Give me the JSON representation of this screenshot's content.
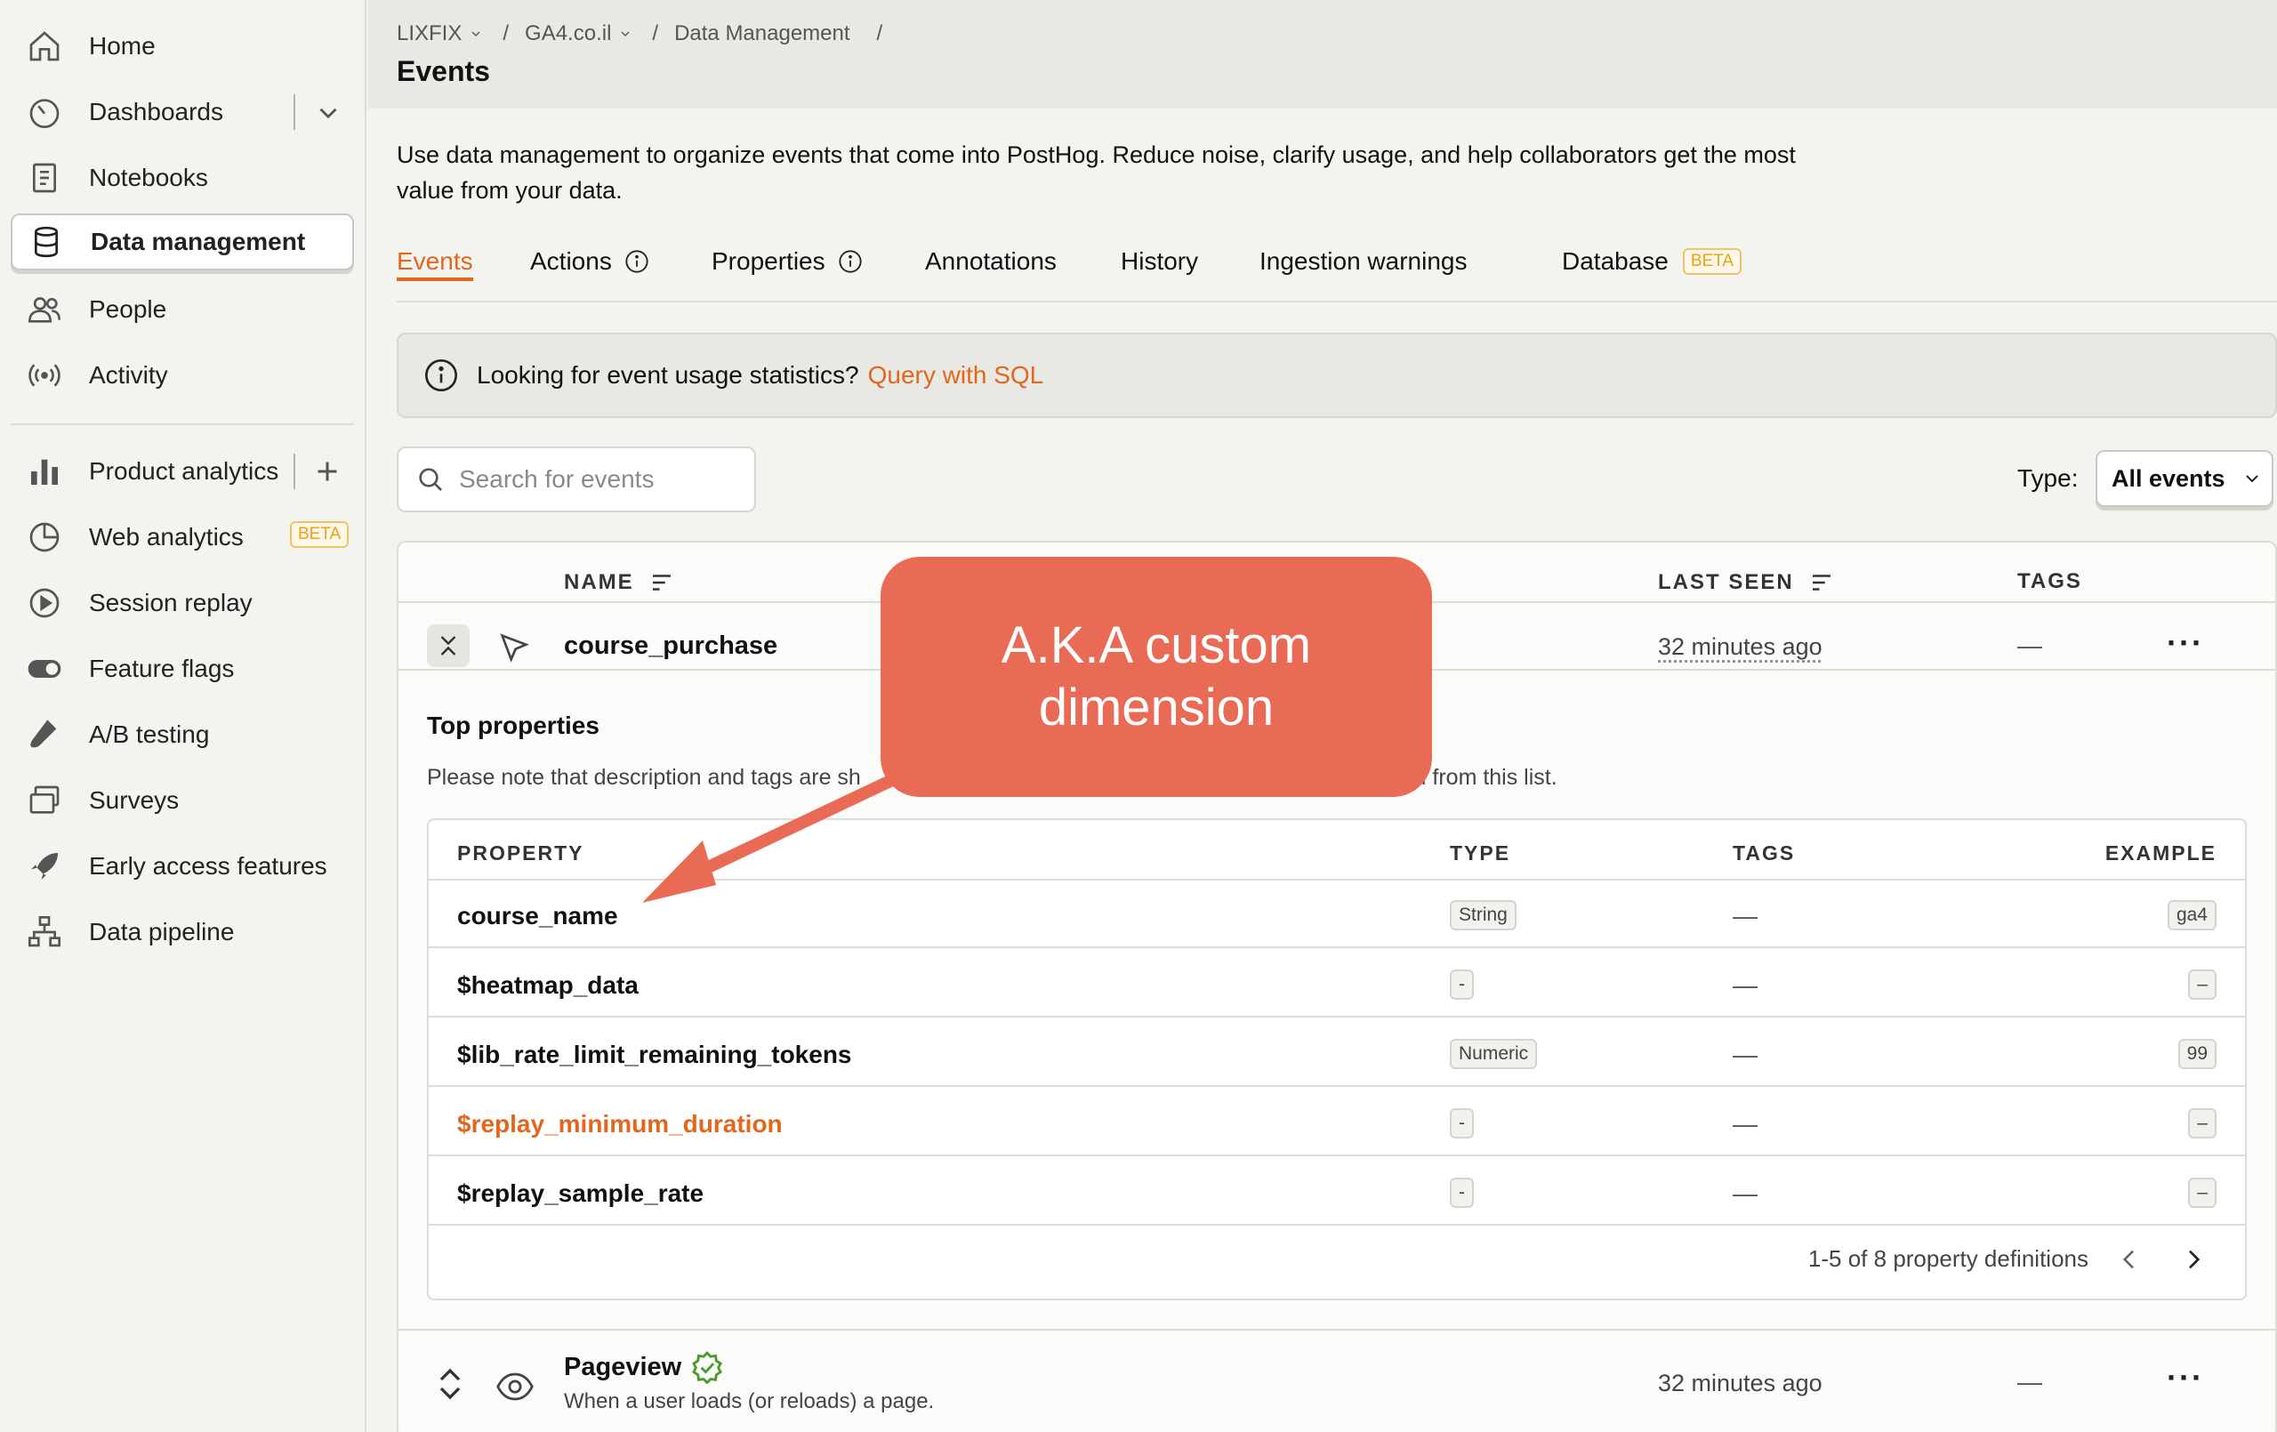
{
  "sidebar": {
    "items": [
      {
        "label": "Home",
        "icon": "home-icon"
      },
      {
        "label": "Dashboards",
        "icon": "dashboard-icon"
      },
      {
        "label": "Notebooks",
        "icon": "notebook-icon"
      },
      {
        "label": "Data management",
        "icon": "database-icon"
      },
      {
        "label": "People",
        "icon": "people-icon"
      },
      {
        "label": "Activity",
        "icon": "activity-icon"
      },
      {
        "label": "Product analytics",
        "icon": "bar-chart-icon"
      },
      {
        "label": "Web analytics",
        "icon": "pie-chart-icon",
        "badge": "BETA"
      },
      {
        "label": "Session replay",
        "icon": "replay-icon"
      },
      {
        "label": "Feature flags",
        "icon": "toggle-icon"
      },
      {
        "label": "A/B testing",
        "icon": "flask-icon"
      },
      {
        "label": "Surveys",
        "icon": "survey-icon"
      },
      {
        "label": "Early access features",
        "icon": "rocket-icon"
      },
      {
        "label": "Data pipeline",
        "icon": "pipeline-icon"
      }
    ]
  },
  "header": {
    "breadcrumbs": [
      "LIXFIX",
      "GA4.co.il",
      "Data Management"
    ],
    "title": "Events"
  },
  "main": {
    "description": "Use data management to organize events that come into PostHog. Reduce noise, clarify usage, and help collaborators get the most value from your data.",
    "tabs": [
      {
        "label": "Events"
      },
      {
        "label": "Actions"
      },
      {
        "label": "Properties"
      },
      {
        "label": "Annotations"
      },
      {
        "label": "History"
      },
      {
        "label": "Ingestion warnings"
      },
      {
        "label": "Database",
        "badge": "BETA"
      }
    ],
    "banner": {
      "text": "Looking for event usage statistics?",
      "link": "Query with SQL"
    },
    "search_placeholder": "Search for events",
    "type_label": "Type:",
    "type_value": "All events",
    "columns": {
      "name": "NAME",
      "last_seen": "LAST SEEN",
      "tags": "TAGS"
    },
    "events": [
      {
        "name": "course_purchase",
        "last_seen": "32 minutes ago",
        "tags": "—"
      },
      {
        "name": "Pageview",
        "description": "When a user loads (or reloads) a page.",
        "last_seen": "32 minutes ago",
        "tags": "—"
      }
    ],
    "top_properties": {
      "title": "Top properties",
      "note_start": "Please note that description and tags are sh",
      "note_end": "uded from this list.",
      "columns": {
        "property": "PROPERTY",
        "type": "TYPE",
        "tags": "TAGS",
        "example": "EXAMPLE"
      },
      "rows": [
        {
          "name": "course_name",
          "type": "String",
          "tags": "—",
          "example": "ga4"
        },
        {
          "name": "$heatmap_data",
          "type": "-",
          "tags": "—",
          "example": "–"
        },
        {
          "name": "$lib_rate_limit_remaining_tokens",
          "type": "Numeric",
          "tags": "—",
          "example": "99"
        },
        {
          "name": "$replay_minimum_duration",
          "type": "-",
          "tags": "—",
          "example": "–"
        },
        {
          "name": "$replay_sample_rate",
          "type": "-",
          "tags": "—",
          "example": "–"
        }
      ],
      "pagination": "1-5 of 8 property definitions"
    }
  },
  "annotation": {
    "text": "A.K.A custom dimension",
    "color": "#ea6b55"
  },
  "colors": {
    "accent": "#e4661c",
    "beta": "#e8a21a",
    "verified": "#4a9a2b"
  }
}
